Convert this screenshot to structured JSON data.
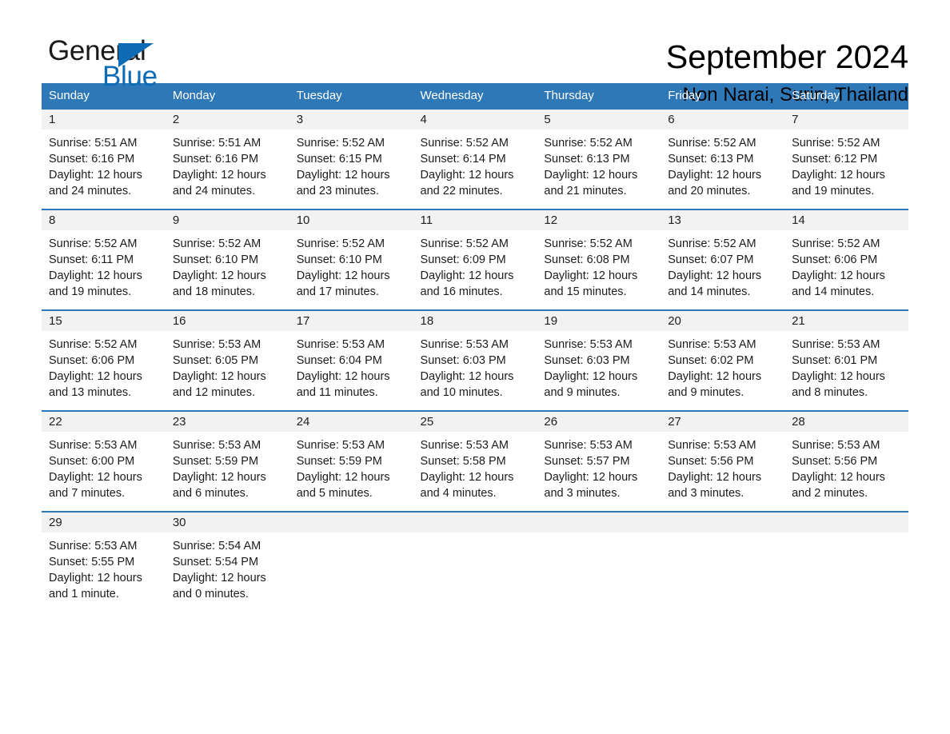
{
  "brand": {
    "name_part1": "General",
    "name_part2": "Blue",
    "accent_color": "#0d6cb5"
  },
  "header": {
    "month_title": "September 2024",
    "location": "Non Narai, Surin, Thailand"
  },
  "calendar": {
    "header_color": "#2e78b8",
    "daynum_band_color": "#f2f2f2",
    "weekday_headers": [
      "Sunday",
      "Monday",
      "Tuesday",
      "Wednesday",
      "Thursday",
      "Friday",
      "Saturday"
    ],
    "weeks": [
      [
        {
          "day": "1",
          "sunrise": "Sunrise: 5:51 AM",
          "sunset": "Sunset: 6:16 PM",
          "daylight_line1": "Daylight: 12 hours",
          "daylight_line2": "and 24 minutes."
        },
        {
          "day": "2",
          "sunrise": "Sunrise: 5:51 AM",
          "sunset": "Sunset: 6:16 PM",
          "daylight_line1": "Daylight: 12 hours",
          "daylight_line2": "and 24 minutes."
        },
        {
          "day": "3",
          "sunrise": "Sunrise: 5:52 AM",
          "sunset": "Sunset: 6:15 PM",
          "daylight_line1": "Daylight: 12 hours",
          "daylight_line2": "and 23 minutes."
        },
        {
          "day": "4",
          "sunrise": "Sunrise: 5:52 AM",
          "sunset": "Sunset: 6:14 PM",
          "daylight_line1": "Daylight: 12 hours",
          "daylight_line2": "and 22 minutes."
        },
        {
          "day": "5",
          "sunrise": "Sunrise: 5:52 AM",
          "sunset": "Sunset: 6:13 PM",
          "daylight_line1": "Daylight: 12 hours",
          "daylight_line2": "and 21 minutes."
        },
        {
          "day": "6",
          "sunrise": "Sunrise: 5:52 AM",
          "sunset": "Sunset: 6:13 PM",
          "daylight_line1": "Daylight: 12 hours",
          "daylight_line2": "and 20 minutes."
        },
        {
          "day": "7",
          "sunrise": "Sunrise: 5:52 AM",
          "sunset": "Sunset: 6:12 PM",
          "daylight_line1": "Daylight: 12 hours",
          "daylight_line2": "and 19 minutes."
        }
      ],
      [
        {
          "day": "8",
          "sunrise": "Sunrise: 5:52 AM",
          "sunset": "Sunset: 6:11 PM",
          "daylight_line1": "Daylight: 12 hours",
          "daylight_line2": "and 19 minutes."
        },
        {
          "day": "9",
          "sunrise": "Sunrise: 5:52 AM",
          "sunset": "Sunset: 6:10 PM",
          "daylight_line1": "Daylight: 12 hours",
          "daylight_line2": "and 18 minutes."
        },
        {
          "day": "10",
          "sunrise": "Sunrise: 5:52 AM",
          "sunset": "Sunset: 6:10 PM",
          "daylight_line1": "Daylight: 12 hours",
          "daylight_line2": "and 17 minutes."
        },
        {
          "day": "11",
          "sunrise": "Sunrise: 5:52 AM",
          "sunset": "Sunset: 6:09 PM",
          "daylight_line1": "Daylight: 12 hours",
          "daylight_line2": "and 16 minutes."
        },
        {
          "day": "12",
          "sunrise": "Sunrise: 5:52 AM",
          "sunset": "Sunset: 6:08 PM",
          "daylight_line1": "Daylight: 12 hours",
          "daylight_line2": "and 15 minutes."
        },
        {
          "day": "13",
          "sunrise": "Sunrise: 5:52 AM",
          "sunset": "Sunset: 6:07 PM",
          "daylight_line1": "Daylight: 12 hours",
          "daylight_line2": "and 14 minutes."
        },
        {
          "day": "14",
          "sunrise": "Sunrise: 5:52 AM",
          "sunset": "Sunset: 6:06 PM",
          "daylight_line1": "Daylight: 12 hours",
          "daylight_line2": "and 14 minutes."
        }
      ],
      [
        {
          "day": "15",
          "sunrise": "Sunrise: 5:52 AM",
          "sunset": "Sunset: 6:06 PM",
          "daylight_line1": "Daylight: 12 hours",
          "daylight_line2": "and 13 minutes."
        },
        {
          "day": "16",
          "sunrise": "Sunrise: 5:53 AM",
          "sunset": "Sunset: 6:05 PM",
          "daylight_line1": "Daylight: 12 hours",
          "daylight_line2": "and 12 minutes."
        },
        {
          "day": "17",
          "sunrise": "Sunrise: 5:53 AM",
          "sunset": "Sunset: 6:04 PM",
          "daylight_line1": "Daylight: 12 hours",
          "daylight_line2": "and 11 minutes."
        },
        {
          "day": "18",
          "sunrise": "Sunrise: 5:53 AM",
          "sunset": "Sunset: 6:03 PM",
          "daylight_line1": "Daylight: 12 hours",
          "daylight_line2": "and 10 minutes."
        },
        {
          "day": "19",
          "sunrise": "Sunrise: 5:53 AM",
          "sunset": "Sunset: 6:03 PM",
          "daylight_line1": "Daylight: 12 hours",
          "daylight_line2": "and 9 minutes."
        },
        {
          "day": "20",
          "sunrise": "Sunrise: 5:53 AM",
          "sunset": "Sunset: 6:02 PM",
          "daylight_line1": "Daylight: 12 hours",
          "daylight_line2": "and 9 minutes."
        },
        {
          "day": "21",
          "sunrise": "Sunrise: 5:53 AM",
          "sunset": "Sunset: 6:01 PM",
          "daylight_line1": "Daylight: 12 hours",
          "daylight_line2": "and 8 minutes."
        }
      ],
      [
        {
          "day": "22",
          "sunrise": "Sunrise: 5:53 AM",
          "sunset": "Sunset: 6:00 PM",
          "daylight_line1": "Daylight: 12 hours",
          "daylight_line2": "and 7 minutes."
        },
        {
          "day": "23",
          "sunrise": "Sunrise: 5:53 AM",
          "sunset": "Sunset: 5:59 PM",
          "daylight_line1": "Daylight: 12 hours",
          "daylight_line2": "and 6 minutes."
        },
        {
          "day": "24",
          "sunrise": "Sunrise: 5:53 AM",
          "sunset": "Sunset: 5:59 PM",
          "daylight_line1": "Daylight: 12 hours",
          "daylight_line2": "and 5 minutes."
        },
        {
          "day": "25",
          "sunrise": "Sunrise: 5:53 AM",
          "sunset": "Sunset: 5:58 PM",
          "daylight_line1": "Daylight: 12 hours",
          "daylight_line2": "and 4 minutes."
        },
        {
          "day": "26",
          "sunrise": "Sunrise: 5:53 AM",
          "sunset": "Sunset: 5:57 PM",
          "daylight_line1": "Daylight: 12 hours",
          "daylight_line2": "and 3 minutes."
        },
        {
          "day": "27",
          "sunrise": "Sunrise: 5:53 AM",
          "sunset": "Sunset: 5:56 PM",
          "daylight_line1": "Daylight: 12 hours",
          "daylight_line2": "and 3 minutes."
        },
        {
          "day": "28",
          "sunrise": "Sunrise: 5:53 AM",
          "sunset": "Sunset: 5:56 PM",
          "daylight_line1": "Daylight: 12 hours",
          "daylight_line2": "and 2 minutes."
        }
      ],
      [
        {
          "day": "29",
          "sunrise": "Sunrise: 5:53 AM",
          "sunset": "Sunset: 5:55 PM",
          "daylight_line1": "Daylight: 12 hours",
          "daylight_line2": "and 1 minute."
        },
        {
          "day": "30",
          "sunrise": "Sunrise: 5:54 AM",
          "sunset": "Sunset: 5:54 PM",
          "daylight_line1": "Daylight: 12 hours",
          "daylight_line2": "and 0 minutes."
        },
        {
          "day": "",
          "sunrise": "",
          "sunset": "",
          "daylight_line1": "",
          "daylight_line2": ""
        },
        {
          "day": "",
          "sunrise": "",
          "sunset": "",
          "daylight_line1": "",
          "daylight_line2": ""
        },
        {
          "day": "",
          "sunrise": "",
          "sunset": "",
          "daylight_line1": "",
          "daylight_line2": ""
        },
        {
          "day": "",
          "sunrise": "",
          "sunset": "",
          "daylight_line1": "",
          "daylight_line2": ""
        },
        {
          "day": "",
          "sunrise": "",
          "sunset": "",
          "daylight_line1": "",
          "daylight_line2": ""
        }
      ]
    ]
  }
}
